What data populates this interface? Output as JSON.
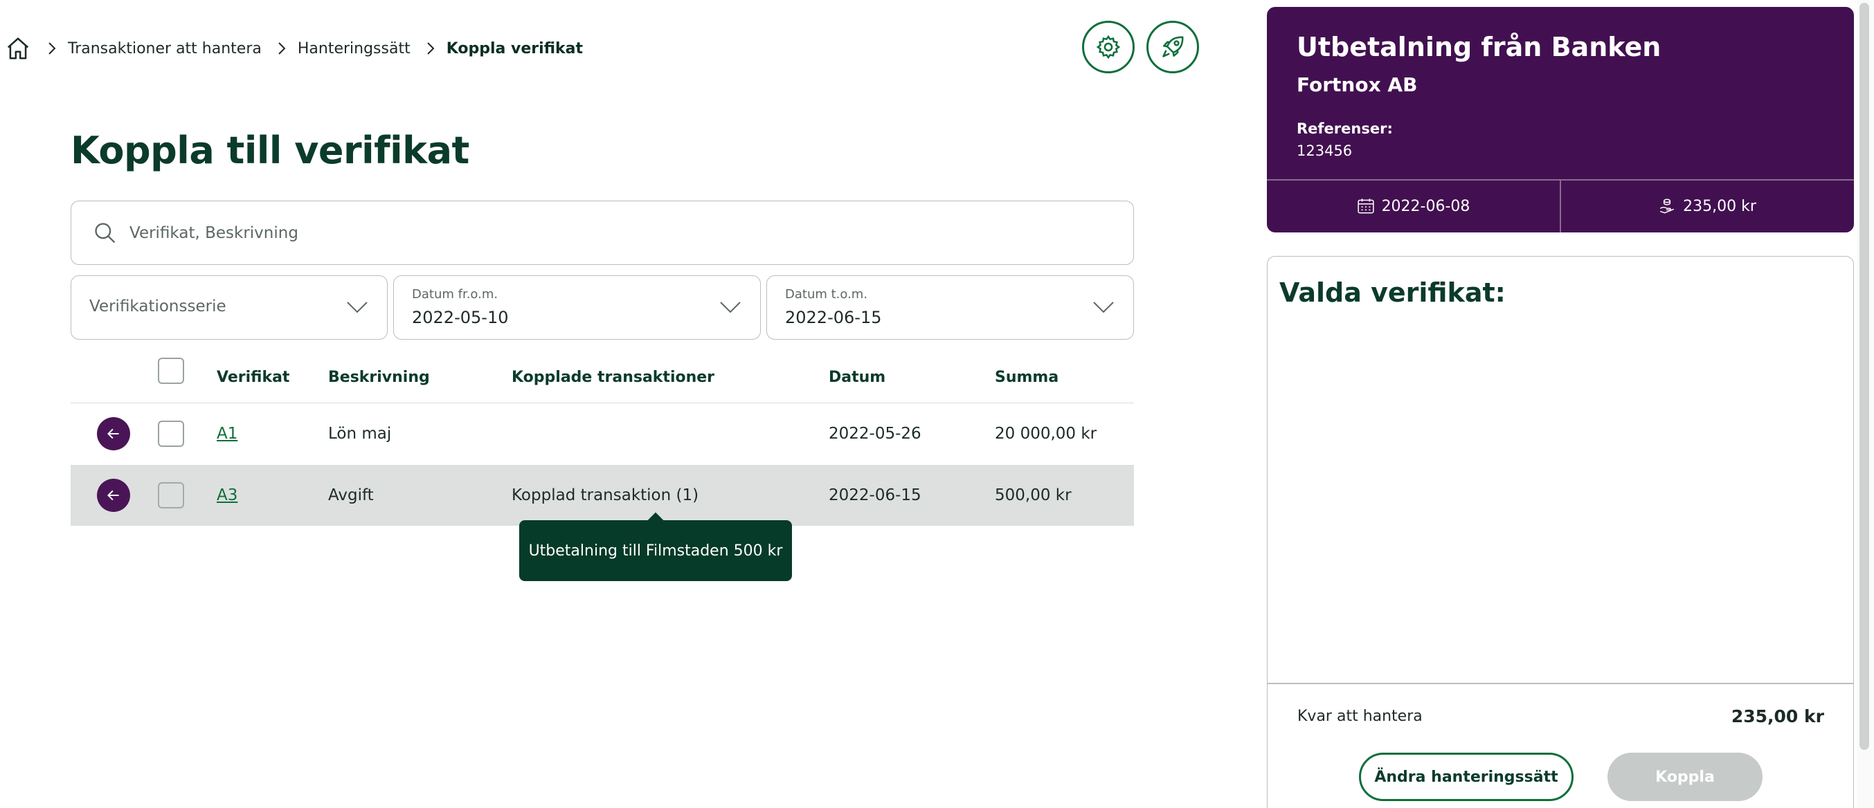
{
  "breadcrumb": {
    "items": [
      "Transaktioner att hantera",
      "Hanteringssätt",
      "Koppla verifikat"
    ]
  },
  "header_icons": [
    "gear-icon",
    "rocket-icon"
  ],
  "page": {
    "title": "Koppla till verifikat"
  },
  "search": {
    "placeholder": "Verifikat, Beskrivning",
    "value": ""
  },
  "filters": {
    "series": {
      "placeholder": "Verifikationsserie"
    },
    "date_from": {
      "label": "Datum fr.o.m.",
      "value": "2022-05-10"
    },
    "date_to": {
      "label": "Datum t.o.m.",
      "value": "2022-06-15"
    }
  },
  "table": {
    "columns": [
      "Verifikat",
      "Beskrivning",
      "Kopplade transaktioner",
      "Datum",
      "Summa"
    ],
    "rows": [
      {
        "verifikat": "A1",
        "beskrivning": "Lön maj",
        "kopplade": "",
        "datum": "2022-05-26",
        "summa": "20 000,00 kr"
      },
      {
        "verifikat": "A3",
        "beskrivning": "Avgift",
        "kopplade": "Kopplad transaktion (1)",
        "datum": "2022-06-15",
        "summa": "500,00 kr"
      }
    ],
    "tooltip": "Utbetalning till Filmstaden 500 kr"
  },
  "transaction": {
    "title": "Utbetalning från Banken",
    "company": "Fortnox AB",
    "references_label": "Referenser:",
    "references_value": "123456",
    "date": "2022-06-08",
    "amount": "235,00 kr"
  },
  "selected": {
    "title": "Valda verifikat:",
    "remaining_label": "Kvar att hantera",
    "remaining_value": "235,00 kr",
    "change_button": "Ändra hanteringssätt",
    "connect_button": "Koppla"
  },
  "colors": {
    "brand_green": "#0e6f3c",
    "dark_green": "#0b3b2a",
    "purple": "#421050",
    "tooltip_bg": "#053b28"
  }
}
